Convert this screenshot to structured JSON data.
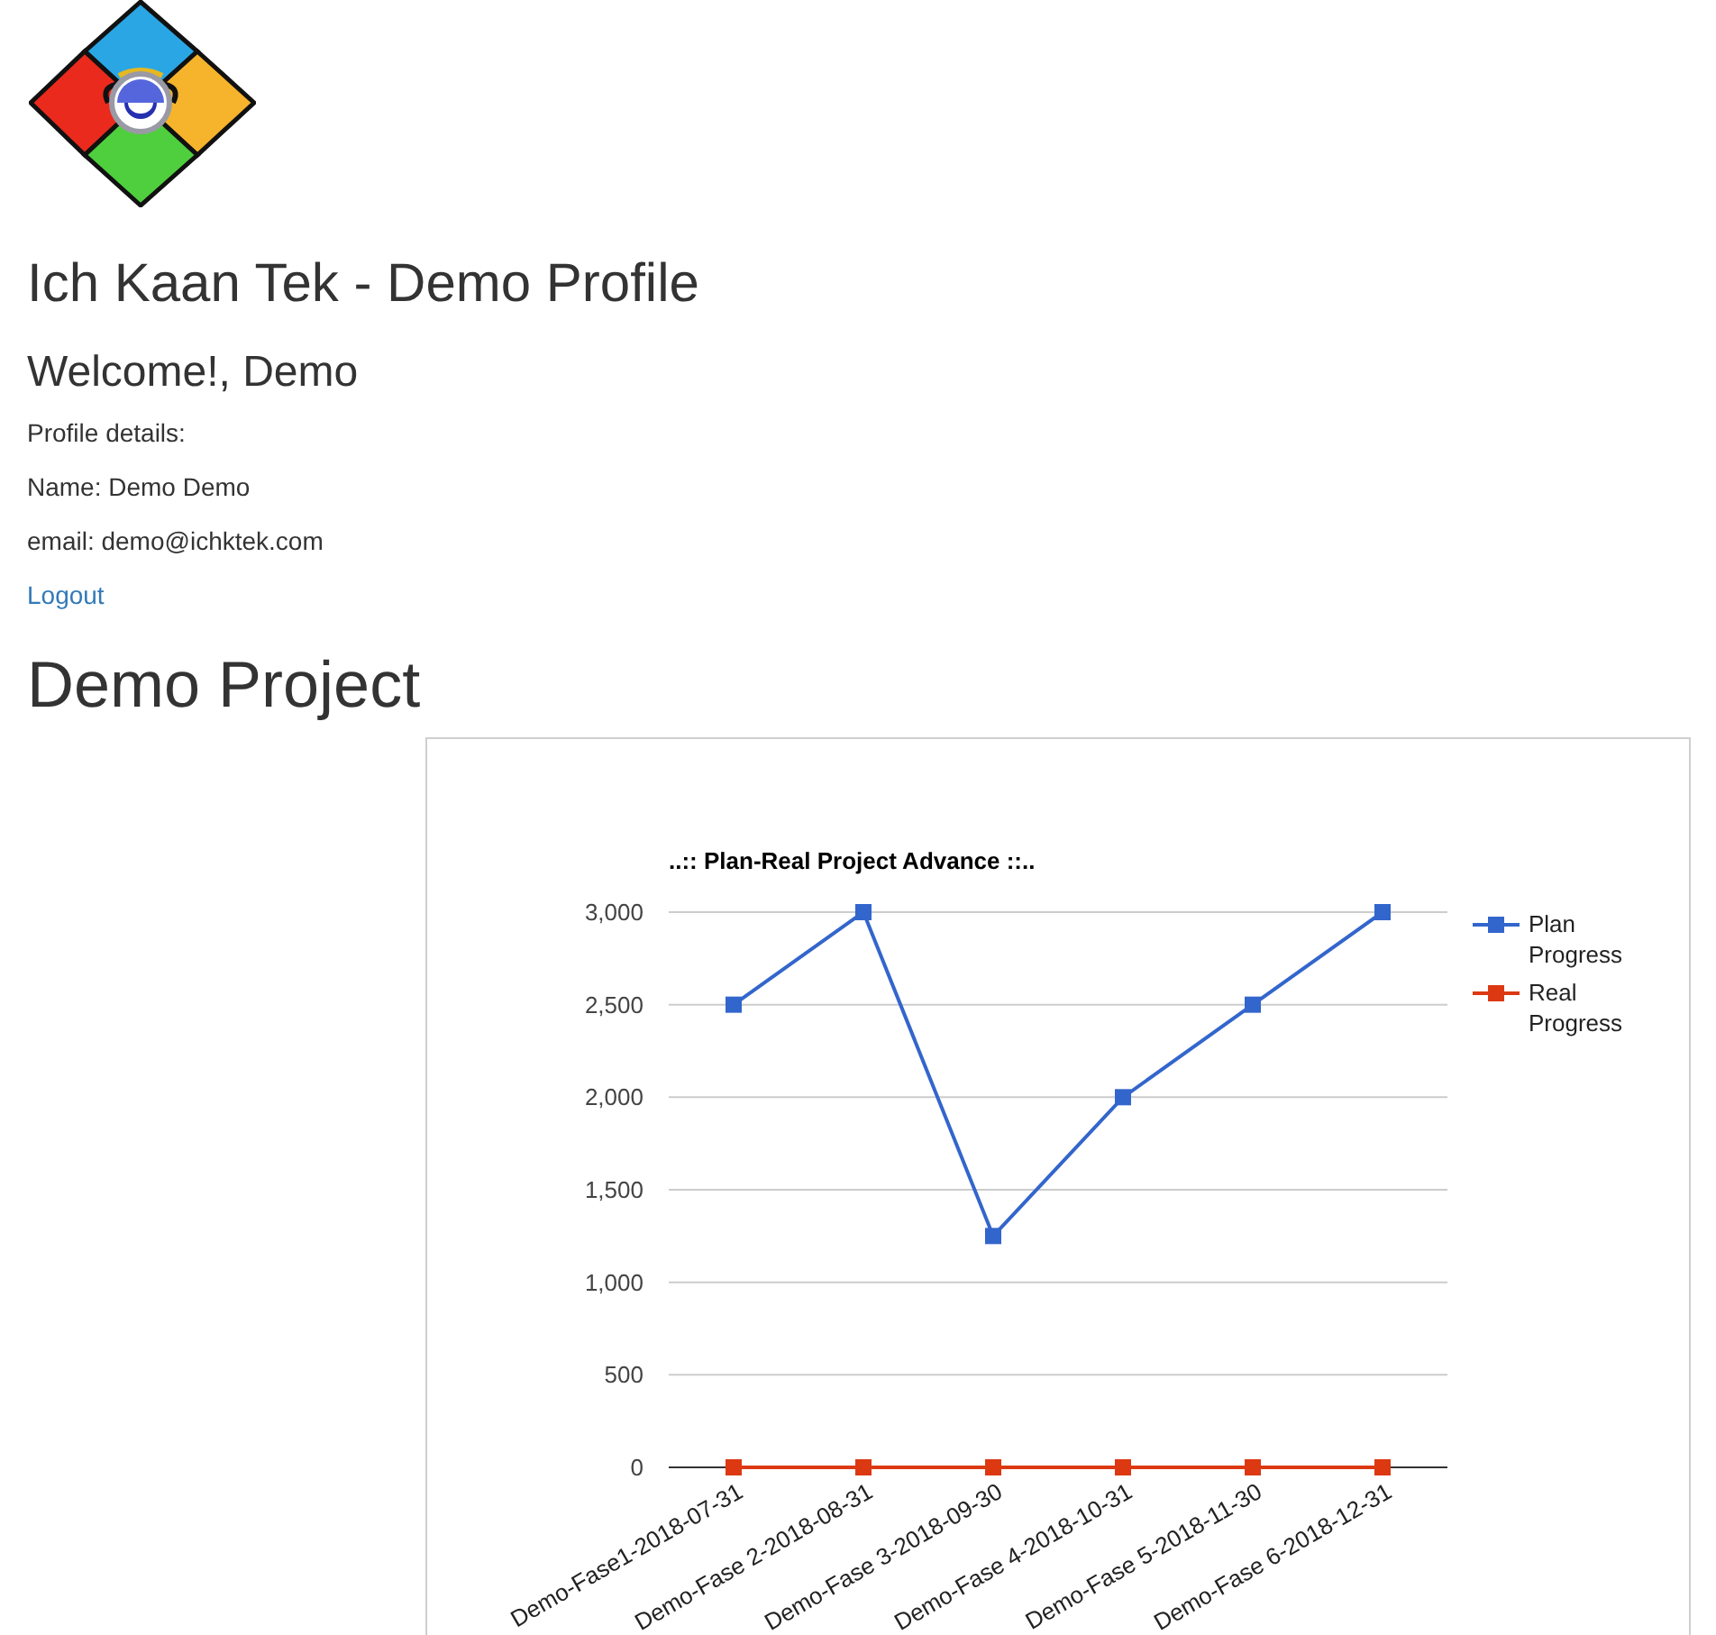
{
  "header": {
    "title": "Ich Kaan Tek - Demo Profile",
    "welcome": "Welcome!, Demo"
  },
  "profile": {
    "heading": "Profile details:",
    "name": "Name: Demo Demo",
    "email": "email: demo@ichktek.com",
    "logout": "Logout"
  },
  "project": {
    "title": "Demo Project",
    "chart_data": {
      "type": "line",
      "title": "..:: Plan-Real Project Advance ::..",
      "grid": true,
      "legend": true,
      "categories": [
        "Demo-Fase1-2018-07-31",
        "Demo-Fase 2-2018-08-31",
        "Demo-Fase 3-2018-09-30",
        "Demo-Fase 4-2018-10-31",
        "Demo-Fase 5-2018-11-30",
        "Demo-Fase 6-2018-12-31"
      ],
      "series": [
        {
          "name": "Plan Progress",
          "color": "#3366cc",
          "marker": "square",
          "values": [
            2500,
            3000,
            1250,
            2000,
            2500,
            3000
          ]
        },
        {
          "name": "Real Progress",
          "color": "#dc3912",
          "marker": "square",
          "values": [
            0,
            0,
            0,
            0,
            0,
            0
          ]
        }
      ],
      "ylim": [
        0,
        3000
      ],
      "yticks": [
        {
          "value": 0,
          "label": "0"
        },
        {
          "value": 500,
          "label": "500"
        },
        {
          "value": 1000,
          "label": "1,000"
        },
        {
          "value": 1500,
          "label": "1,500"
        },
        {
          "value": 2000,
          "label": "2,000"
        },
        {
          "value": 2500,
          "label": "2,500"
        },
        {
          "value": 3000,
          "label": "3,000"
        }
      ]
    }
  }
}
